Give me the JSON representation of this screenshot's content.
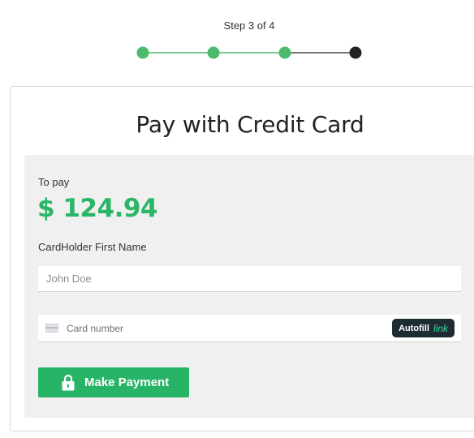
{
  "stepper": {
    "label": "Step 3 of 4",
    "current": 3,
    "total": 4,
    "completed_color": "#4cbb6c",
    "pending_color": "#222222"
  },
  "payment": {
    "title": "Pay with Credit Card",
    "to_pay_label": "To pay",
    "amount": "$ 124.94",
    "amount_color": "#2bb566",
    "first_name_label": "CardHolder First Name",
    "first_name_placeholder": "John Doe",
    "first_name_value": "",
    "card_number_placeholder": "Card number",
    "autofill_label": "Autofill",
    "autofill_brand": "link",
    "submit_label": "Make Payment",
    "submit_color": "#27b467",
    "card_icon": "credit-card-icon",
    "submit_icon": "lock-icon"
  }
}
